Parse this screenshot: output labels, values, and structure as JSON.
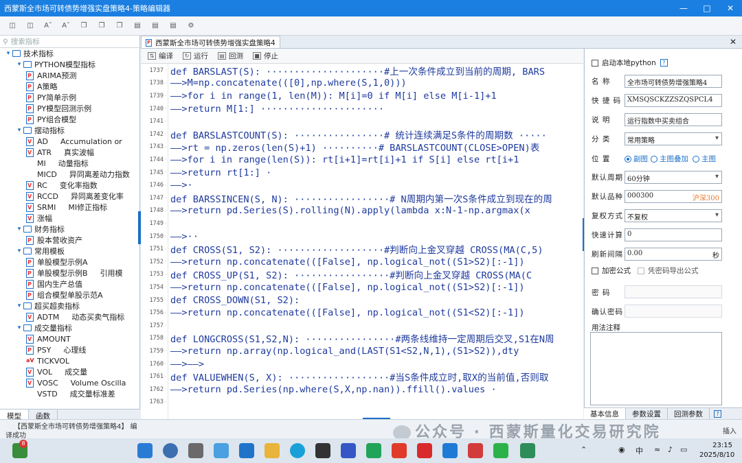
{
  "window": {
    "title": "西蒙斯全市场可转债势增强实盘策略4-策略编辑器"
  },
  "left": {
    "search_placeholder": "搜索指标",
    "tree": [
      {
        "level": 0,
        "kind": "folder",
        "label": "技术指标"
      },
      {
        "level": 1,
        "kind": "folder",
        "label": "PYTHON模型指标"
      },
      {
        "level": 2,
        "kind": "py",
        "label": "ARIMA预测"
      },
      {
        "level": 2,
        "kind": "py",
        "label": "A策略"
      },
      {
        "level": 2,
        "kind": "py",
        "label": "PY简单示例"
      },
      {
        "level": 2,
        "kind": "py",
        "label": "PY模型回测示例"
      },
      {
        "level": 2,
        "kind": "py",
        "label": "PY组合模型"
      },
      {
        "level": 1,
        "kind": "folder",
        "label": "摆动指标"
      },
      {
        "level": 2,
        "kind": "v",
        "label": "AD",
        "desc": "Accumulation or"
      },
      {
        "level": 2,
        "kind": "v",
        "label": "ATR",
        "desc": "真实波幅"
      },
      {
        "level": 2,
        "kind": "none",
        "label": "MI",
        "desc": "动量指标"
      },
      {
        "level": 2,
        "kind": "none",
        "label": "MICD",
        "desc": "异同离差动力指数"
      },
      {
        "level": 2,
        "kind": "v",
        "label": "RC",
        "desc": "变化率指数"
      },
      {
        "level": 2,
        "kind": "v",
        "label": "RCCD",
        "desc": "异同离差变化率"
      },
      {
        "level": 2,
        "kind": "v",
        "label": "SRMI",
        "desc": "MI修正指标"
      },
      {
        "level": 2,
        "kind": "v",
        "label": "涨幅"
      },
      {
        "level": 1,
        "kind": "folder",
        "label": "财务指标"
      },
      {
        "level": 2,
        "kind": "py",
        "label": "股本营收资产"
      },
      {
        "level": 1,
        "kind": "folder",
        "label": "常用模板"
      },
      {
        "level": 2,
        "kind": "py",
        "label": "单股模型示例A"
      },
      {
        "level": 2,
        "kind": "py",
        "label": "单股模型示例B",
        "desc": "引用模"
      },
      {
        "level": 2,
        "kind": "py",
        "label": "国内生产总值"
      },
      {
        "level": 2,
        "kind": "py",
        "label": "组合模型单股示范A"
      },
      {
        "level": 1,
        "kind": "folder",
        "label": "超买超卖指标"
      },
      {
        "level": 2,
        "kind": "v",
        "label": "ADTM",
        "desc": "动态买卖气指标"
      },
      {
        "level": 1,
        "kind": "folder",
        "label": "成交量指标"
      },
      {
        "level": 2,
        "kind": "v",
        "label": "AMOUNT"
      },
      {
        "level": 2,
        "kind": "py",
        "label": "PSY",
        "desc": "心理线"
      },
      {
        "level": 2,
        "kind": "av",
        "label": "TICKVOL"
      },
      {
        "level": 2,
        "kind": "v",
        "label": "VOL",
        "desc": "成交量"
      },
      {
        "level": 2,
        "kind": "v",
        "label": "VOSC",
        "desc": "Volume Oscilla"
      },
      {
        "level": 2,
        "kind": "none",
        "label": "VSTD",
        "desc": "成交量标准差"
      }
    ],
    "tabs": [
      "模型",
      "函数"
    ]
  },
  "editor": {
    "tab_label": "西蒙斯全市场可转债势增强实盘策略4",
    "tools": [
      "编译",
      "运行",
      "回测",
      "停止"
    ],
    "lines": [
      {
        "n": "1737",
        "t": "def BARSLAST(S): ·····················#上一次条件成立到当前的周期, BARS"
      },
      {
        "n": "1738",
        "t": "——>M=np.concatenate(([0],np.where(S,1,0)))"
      },
      {
        "n": "1739",
        "t": "——>for i in range(1, len(M)):  M[i]=0 if M[i] else M[i-1]+1"
      },
      {
        "n": "1740",
        "t": "——>return M[1:] ······················"
      },
      {
        "n": "1741",
        "t": ""
      },
      {
        "n": "1742",
        "t": "def BARSLASTCOUNT(S): ················# 统计连续满足S条件的周期数 ·····"
      },
      {
        "n": "1743",
        "t": "——>rt = np.zeros(len(S)+1) ··········# BARSLASTCOUNT(CLOSE>OPEN)表"
      },
      {
        "n": "1744",
        "t": "——>for i in range(len(S)): rt[i+1]=rt[i]+1  if S[i] else rt[i+1"
      },
      {
        "n": "1745",
        "t": "——>return rt[1:] ·"
      },
      {
        "n": "1746",
        "t": "——>·"
      },
      {
        "n": "1747",
        "t": "def BARSSINCEN(S, N): ·················# N周期内第一次S条件成立到现在的周"
      },
      {
        "n": "1748",
        "t": "——>return pd.Series(S).rolling(N).apply(lambda x:N-1-np.argmax(x"
      },
      {
        "n": "1749",
        "t": ""
      },
      {
        "n": "1750",
        "t": "——>··"
      },
      {
        "n": "1751",
        "t": "def CROSS(S1, S2): ···················#判断向上金叉穿越 CROSS(MA(C,5)"
      },
      {
        "n": "1752",
        "t": "——>return np.concatenate(([False], np.logical_not((S1>S2)[:-1])"
      },
      {
        "n": "1753",
        "t": "def CROSS_UP(S1, S2): ·················#判断向上金叉穿越 CROSS(MA(C"
      },
      {
        "n": "1754",
        "t": "——>return np.concatenate(([False], np.logical_not((S1>S2)[:-1])"
      },
      {
        "n": "1755",
        "t": "def CROSS_DOWN(S1, S2):"
      },
      {
        "n": "1756",
        "t": "——>return np.concatenate(([False], np.logical_not((S1<S2)[:-1])"
      },
      {
        "n": "1757",
        "t": ""
      },
      {
        "n": "1758",
        "t": "def LONGCROSS(S1,S2,N): ················#两条线维持一定周期后交叉,S1在N周"
      },
      {
        "n": "1759",
        "t": "——>return  np.array(np.logical_and(LAST(S1<S2,N,1),(S1>S2)),dty"
      },
      {
        "n": "1760",
        "t": "——>——>"
      },
      {
        "n": "1761",
        "t": "def VALUEWHEN(S, X): ··················#当S条件成立时,取X的当前值,否则取"
      },
      {
        "n": "1762",
        "t": "——>return pd.Series(np.where(S,X,np.nan)).ffill().values ·"
      },
      {
        "n": "1763",
        "t": ""
      }
    ]
  },
  "props": {
    "local_python_label": "启动本地python",
    "name_label": "名  称",
    "name_value": "全市场可转债势增强策略4",
    "code_label": "快 捷 码",
    "code_value": "XMSQSCKZZSZQSPCL4",
    "desc_label": "说  明",
    "desc_value": "运行指数中买卖组合",
    "cat_label": "分  类",
    "cat_value": "常用策略",
    "pos_label": "位  置",
    "pos_opts": [
      "副图",
      "主图叠加",
      "主图"
    ],
    "period_label": "默认周期",
    "period_value": "60分钟",
    "variety_label": "默认品种",
    "variety_value": "000300",
    "variety_name": "沪深300",
    "rights_label": "复权方式",
    "rights_value": "不复权",
    "calc_label": "快速计算",
    "calc_value": "0",
    "refresh_label": "刷新间隔",
    "refresh_value": "0.00",
    "refresh_unit": "秒",
    "encrypt_label": "加密公式",
    "export_label": "凭密码导出公式",
    "pwd_label": "密  码",
    "pwd_confirm_label": "确认密码",
    "usage_label": "用法注释",
    "tabs": [
      "基本信息",
      "参数设置",
      "回测参数"
    ]
  },
  "status": {
    "line1": "【西蒙斯全市场可转债势增强策略4】 编",
    "line2": "译成功",
    "insert": "插入"
  },
  "watermark": "公众号 · 西蒙斯量化交易研究院",
  "taskbar": {
    "badge": "8",
    "ime": "中",
    "time": "23:15",
    "date": "2025/8/10"
  }
}
